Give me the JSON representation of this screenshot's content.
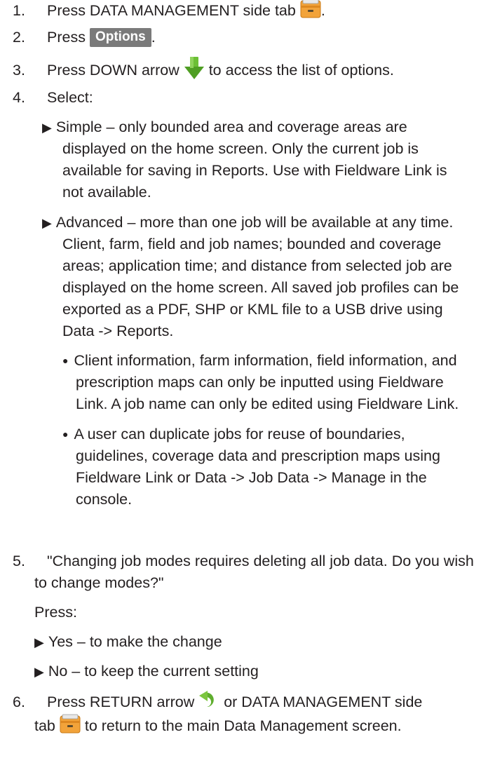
{
  "steps": [
    {
      "num": "1.",
      "pre": "Press DATA MANAGEMENT side tab",
      "post": "."
    },
    {
      "num": "2.",
      "pre": "Press",
      "button": "Options",
      "post": "."
    },
    {
      "num": "3.",
      "pre": "Press DOWN arrow",
      "post": "to access the list of options."
    },
    {
      "num": "4.",
      "text": "Select:"
    },
    {
      "num": "5.",
      "line1": "\"Changing job modes requires deleting all job data. Do you wish",
      "line2": "to change modes?\"",
      "press": "Press:"
    },
    {
      "num": "6.",
      "pre": "Press RETURN arrow",
      "mid": "or DATA MANAGEMENT side",
      "line2_pre": "tab",
      "line2_post": "to return to the main Data Management screen."
    }
  ],
  "simple_lines": [
    "Simple – only bounded area and coverage areas are",
    "displayed on the home screen. Only the current job is",
    "available for saving in Reports. Use with Fieldware Link is",
    "not available."
  ],
  "advanced_lines": [
    "Advanced – more than one job will be available at any time.",
    "Client, farm, field and job names; bounded and coverage",
    "areas; application time; and distance from selected job are",
    "displayed on the home screen. All saved job profiles can be",
    "exported as a PDF, SHP or KML file to a USB drive using",
    "Data -> Reports."
  ],
  "bullet1_lines": [
    "Client information, farm information, field information, and",
    "prescription maps can only be inputted using Fieldware",
    "Link. A job name can only be edited using Fieldware Link."
  ],
  "bullet2_lines": [
    "A user can duplicate jobs for reuse of boundaries,",
    "guidelines, coverage data and prescription maps using",
    "Fieldware Link or Data -> Job Data -> Manage in the",
    "console."
  ],
  "yes_option": "Yes – to make the change",
  "no_option": "No – to keep the current setting",
  "icons": [
    "data-management-tab-icon",
    "down-arrow-icon",
    "return-arrow-icon"
  ],
  "colors": {
    "text": "#231f20",
    "options_button": "#7a7a7a",
    "arrow_green": "#5fae2e",
    "folder_orange": "#f2a33a"
  }
}
